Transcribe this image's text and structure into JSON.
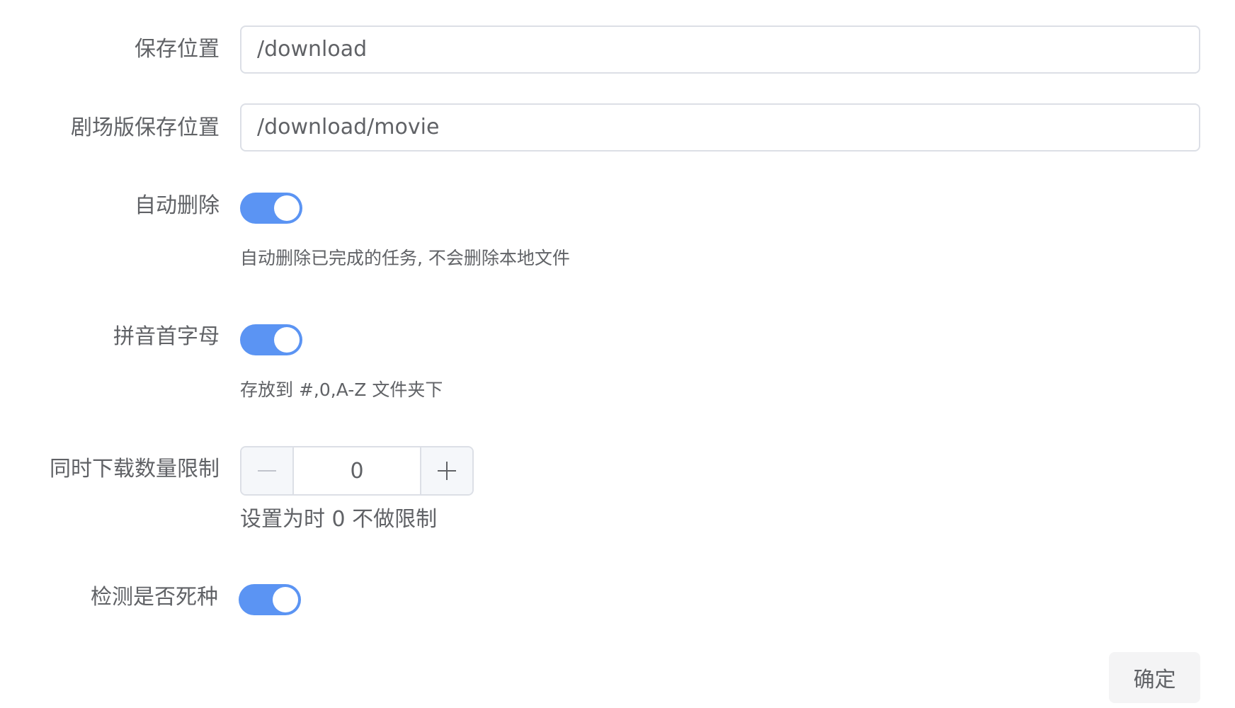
{
  "form": {
    "save_location": {
      "label": "保存位置",
      "value": "/download"
    },
    "movie_save_location": {
      "label": "剧场版保存位置",
      "value": "/download/movie"
    },
    "auto_delete": {
      "label": "自动删除",
      "enabled": true,
      "hint": "自动删除已完成的任务, 不会删除本地文件"
    },
    "pinyin_initial": {
      "label": "拼音首字母",
      "enabled": true,
      "hint": "存放到 #,0,A-Z 文件夹下"
    },
    "concurrent_limit": {
      "label": "同时下载数量限制",
      "value": "0",
      "minus_icon": "minus-icon",
      "plus_icon": "plus-icon",
      "hint": "设置为时 0 不做限制"
    },
    "dead_torrent_check": {
      "label": "检测是否死种",
      "enabled": true
    },
    "confirm_label": "确定"
  },
  "colors": {
    "switch_on": "#5b94f3",
    "text": "#606266",
    "border": "#dcdfe6",
    "button_bg": "#f4f4f5"
  }
}
